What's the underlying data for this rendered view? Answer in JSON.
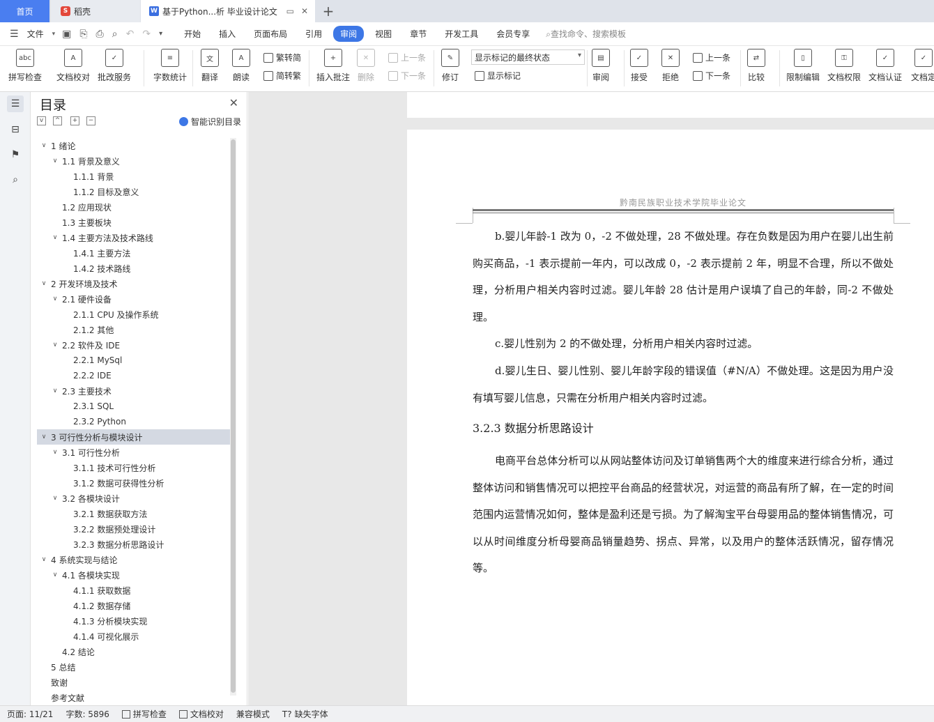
{
  "tabs": {
    "home": "首页",
    "daoke": "稻壳",
    "doc": "基于Python...析 毕业设计论文",
    "add": "+"
  },
  "menu": {
    "file": "文件",
    "tabs": [
      "开始",
      "插入",
      "页面布局",
      "引用",
      "审阅",
      "视图",
      "章节",
      "开发工具",
      "会员专享"
    ],
    "active_tab": "审阅",
    "search": "查找命令、搜索模板"
  },
  "ribbon": {
    "spellcheck": "拼写检查",
    "doc_check": "文档校对",
    "batch_service": "批改服务",
    "word_count": "字数统计",
    "translate": "翻译",
    "read_aloud": "朗读",
    "trad": "繁转简",
    "simp": "简转繁",
    "insert_comment": "插入批注",
    "delete": "删除",
    "prev_comment": "上一条",
    "next_comment": "下一条",
    "track": "修订",
    "markup_state": "显示标记的最终状态",
    "show_markup": "显示标记",
    "review": "审阅",
    "accept": "接受",
    "reject": "拒绝",
    "prev_change": "上一条",
    "next_change": "下一条",
    "compare": "比较",
    "restrict": "限制编辑",
    "doc_perm": "文档权限",
    "doc_cert": "文档认证",
    "doc_fix": "文档定"
  },
  "toc": {
    "title": "目录",
    "smart": "智能识别目录",
    "items": [
      {
        "label": "1  绪论",
        "level": 0,
        "caret": "v"
      },
      {
        "label": "1.1  背景及意义",
        "level": 1,
        "caret": "v"
      },
      {
        "label": "1.1.1  背景",
        "level": 2,
        "caret": ""
      },
      {
        "label": "1.1.2  目标及意义",
        "level": 2,
        "caret": ""
      },
      {
        "label": "1.2  应用现状",
        "level": 1,
        "caret": ""
      },
      {
        "label": "1.3  主要板块",
        "level": 1,
        "caret": ""
      },
      {
        "label": "1.4  主要方法及技术路线",
        "level": 1,
        "caret": "v"
      },
      {
        "label": "1.4.1  主要方法",
        "level": 2,
        "caret": ""
      },
      {
        "label": "1.4.2  技术路线",
        "level": 2,
        "caret": ""
      },
      {
        "label": "2 开发环境及技术",
        "level": 0,
        "caret": "v"
      },
      {
        "label": "2.1 硬件设备",
        "level": 1,
        "caret": "v"
      },
      {
        "label": "2.1.1 CPU 及操作系统",
        "level": 2,
        "caret": ""
      },
      {
        "label": "2.1.2  其他",
        "level": 2,
        "caret": ""
      },
      {
        "label": "2.2 软件及 IDE",
        "level": 1,
        "caret": "v"
      },
      {
        "label": "2.2.1 MySql",
        "level": 2,
        "caret": ""
      },
      {
        "label": "2.2.2 IDE",
        "level": 2,
        "caret": ""
      },
      {
        "label": "2.3 主要技术",
        "level": 1,
        "caret": "v"
      },
      {
        "label": "2.3.1 SQL",
        "level": 2,
        "caret": ""
      },
      {
        "label": "2.3.2 Python",
        "level": 2,
        "caret": ""
      },
      {
        "label": "3  可行性分析与模块设计",
        "level": 0,
        "caret": "v",
        "selected": true
      },
      {
        "label": "3.1  可行性分析",
        "level": 1,
        "caret": "v"
      },
      {
        "label": "3.1.1  技术可行性分析",
        "level": 2,
        "caret": ""
      },
      {
        "label": "3.1.2  数据可获得性分析",
        "level": 2,
        "caret": ""
      },
      {
        "label": "3.2  各模块设计",
        "level": 1,
        "caret": "v"
      },
      {
        "label": "3.2.1  数据获取方法",
        "level": 2,
        "caret": ""
      },
      {
        "label": "3.2.2  数据预处理设计",
        "level": 2,
        "caret": ""
      },
      {
        "label": "3.2.3  数据分析思路设计",
        "level": 2,
        "caret": ""
      },
      {
        "label": "4  系统实现与结论",
        "level": 0,
        "caret": "v"
      },
      {
        "label": "4.1  各模块实现",
        "level": 1,
        "caret": "v"
      },
      {
        "label": "4.1.1  获取数据",
        "level": 2,
        "caret": ""
      },
      {
        "label": "4.1.2  数据存储",
        "level": 2,
        "caret": ""
      },
      {
        "label": "4.1.3  分析模块实现",
        "level": 2,
        "caret": ""
      },
      {
        "label": "4.1.4  可视化展示",
        "level": 2,
        "caret": ""
      },
      {
        "label": "4.2  结论",
        "level": 1,
        "caret": ""
      },
      {
        "label": "5 总结",
        "level": 0,
        "caret": ""
      },
      {
        "label": "致谢",
        "level": 0,
        "caret": ""
      },
      {
        "label": "参考文献",
        "level": 0,
        "caret": ""
      }
    ]
  },
  "doc": {
    "header": "黔南民族职业技术学院毕业论文",
    "para_b": "b.婴儿年龄-1 改为 0，-2 不做处理，28 不做处理。存在负数是因为用户在婴儿出生前购买商品，-1 表示提前一年内，可以改成 0，-2 表示提前 2 年，明显不合理，所以不做处理，分析用户相关内容时过滤。婴儿年龄 28 估计是用户误填了自己的年龄，同-2 不做处理。",
    "para_c": "c.婴儿性别为 2 的不做处理，分析用户相关内容时过滤。",
    "para_d": "d.婴儿生日、婴儿性别、婴儿年龄字段的错误值（#N/A）不做处理。这是因为用户没有填写婴儿信息，只需在分析用户相关内容时过滤。",
    "heading": "3.2.3  数据分析思路设计",
    "para_main": "电商平台总体分析可以从网站整体访问及订单销售两个大的维度来进行综合分析，通过整体访问和销售情况可以把控平台商品的经营状况，对运营的商品有所了解，在一定的时间范围内运营情况如何，整体是盈利还是亏损。为了解淘宝平台母婴用品的整体销售情况，可以从时间维度分析母婴商品销量趋势、拐点、异常，以及用户的整体活跃情况，留存情况等。"
  },
  "status": {
    "page": "页面: 11/21",
    "words": "字数: 5896",
    "spell": "拼写检查",
    "proof": "文档校对",
    "compat": "兼容模式",
    "missing_font": "缺失字体"
  }
}
